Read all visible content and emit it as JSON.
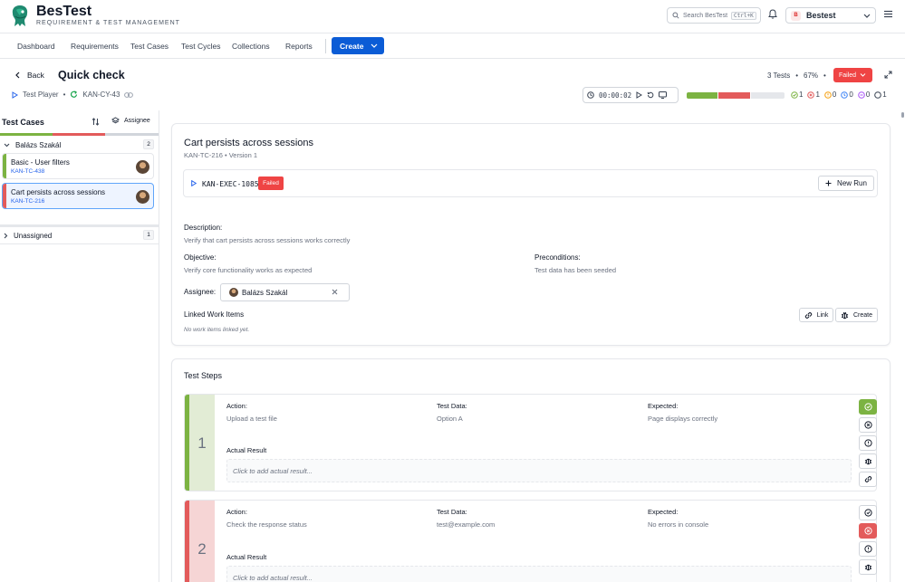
{
  "header": {
    "brand": "BesTest",
    "subtitle": "REQUIREMENT & TEST MANAGEMENT",
    "search_placeholder": "Search BesTest",
    "search_shortcut": "Ctrl+K",
    "workspace_initial": "B",
    "workspace_name": "Bestest"
  },
  "nav": {
    "items": [
      "Dashboard",
      "Requirements",
      "Test Cases",
      "Test Cycles",
      "Collections",
      "Reports"
    ],
    "create_label": "Create"
  },
  "title_row": {
    "back_label": "Back",
    "title": "Quick check",
    "tests_count": "3 Tests",
    "percent": "67%",
    "status": "Failed"
  },
  "player_row": {
    "mode": "Test Player",
    "cycle_key": "KAN-CY-43",
    "timer": "00:00:02",
    "progress": {
      "passed_fraction": 0.333,
      "failed_fraction": 0.333
    },
    "counters": {
      "passed": "1",
      "failed": "1",
      "blocked": "0",
      "in_progress": "0",
      "skipped": "0",
      "not_run": "1"
    },
    "colors": {
      "passed": "#7cb342",
      "failed": "#e35b5b",
      "blocked": "#f59e0b",
      "in_progress": "#3b82f6",
      "skipped": "#a855f7",
      "not_run": "#374151"
    }
  },
  "left_panel": {
    "heading": "Test Cases",
    "group_by_label": "Assignee",
    "groups": [
      {
        "name": "Balázs Szakál",
        "count": "2"
      },
      {
        "name": "Unassigned",
        "count": "1"
      }
    ],
    "cases": [
      {
        "title": "Basic - User filters",
        "key": "KAN-TC-438",
        "status_color": "#7cb342"
      },
      {
        "title": "Cart persists across sessions",
        "key": "KAN-TC-216",
        "status_color": "#e35b5b"
      }
    ]
  },
  "test_case": {
    "title": "Cart persists across sessions",
    "key_version": "KAN-TC-216 • Version 1",
    "execution_id": "KAN-EXEC-1085",
    "execution_status": "Failed",
    "new_run_label": "New Run",
    "description_label": "Description:",
    "description": "Verify that cart persists across sessions works correctly",
    "objective_label": "Objective:",
    "objective": "Verify core functionality works as expected",
    "preconditions_label": "Preconditions:",
    "preconditions": "Test data has been seeded",
    "assignee_label": "Assignee:",
    "assignee": "Balázs Szakál",
    "linked_label": "Linked Work Items",
    "link_label": "Link",
    "create_label": "Create",
    "no_items": "No work items linked yet."
  },
  "steps": {
    "title": "Test Steps",
    "action_label": "Action:",
    "data_label": "Test Data:",
    "expected_label": "Expected:",
    "actual_label": "Actual Result",
    "actual_placeholder": "Click to add actual result...",
    "items": [
      {
        "number": "1",
        "action": "Upload a test file",
        "data": "Option A",
        "expected": "Page displays correctly",
        "status": "passed"
      },
      {
        "number": "2",
        "action": "Check the response status",
        "data": "test@example.com",
        "expected": "No errors in console",
        "status": "failed"
      }
    ]
  }
}
